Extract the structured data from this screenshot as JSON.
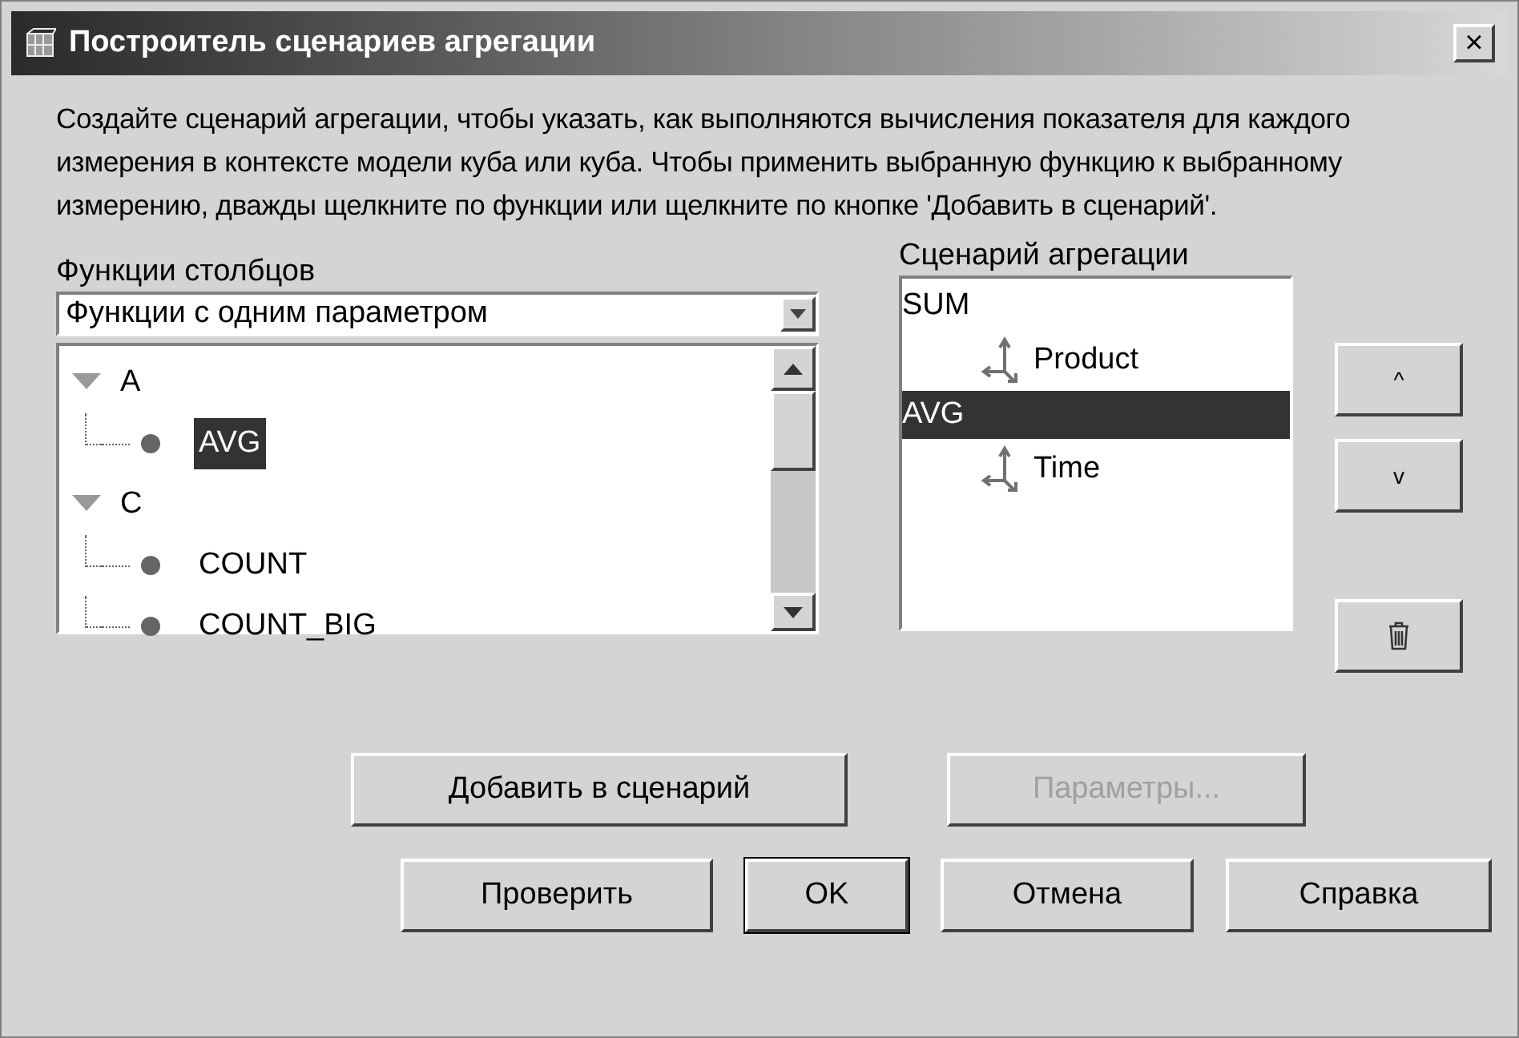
{
  "window": {
    "title": "Построитель сценариев агрегации",
    "close": "×"
  },
  "description": "Создайте сценарий агрегации, чтобы указать, как выполняются вычисления показателя для каждого измерения в контексте модели куба или куба. Чтобы применить выбранную функцию к выбранному измерению, дважды щелкните по функции или щелкните по кнопке 'Добавить в сценарий'.",
  "functions": {
    "label": "Функции столбцов",
    "combo": {
      "value": "Функции с одним параметром"
    },
    "tree": [
      {
        "label": "A",
        "expanded": true,
        "children": [
          {
            "label": "AVG",
            "selected": true
          }
        ]
      },
      {
        "label": "C",
        "expanded": true,
        "children": [
          {
            "label": "COUNT",
            "selected": false
          },
          {
            "label": "COUNT_BIG",
            "selected": false
          }
        ]
      }
    ]
  },
  "scenario": {
    "label": "Сценарий агрегации",
    "items": [
      {
        "label": "SUM",
        "selected": false,
        "children": [
          {
            "label": "Product"
          }
        ]
      },
      {
        "label": "AVG",
        "selected": true,
        "children": [
          {
            "label": "Time"
          }
        ]
      }
    ],
    "move_buttons": [
      {
        "label": "^"
      },
      {
        "label": "v"
      }
    ]
  },
  "middle_buttons": [
    {
      "label": "Добавить в сценарий",
      "disabled": false
    },
    {
      "label": "Параметры...",
      "disabled": true
    }
  ],
  "buttons": [
    {
      "label": "Проверить",
      "default": false
    },
    {
      "label": "OK",
      "default": true
    },
    {
      "label": "Отмена",
      "default": false
    },
    {
      "label": "Справка",
      "default": false
    }
  ]
}
